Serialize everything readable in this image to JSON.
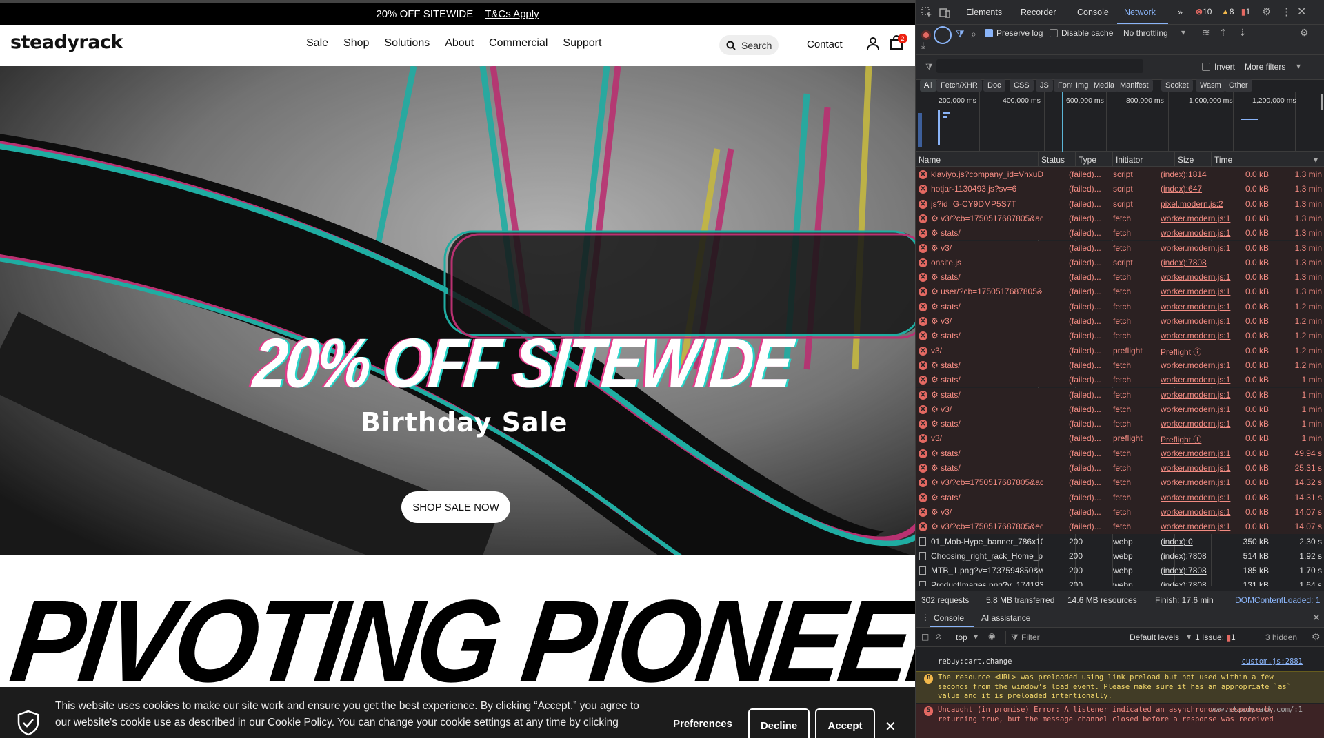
{
  "promo": {
    "text": "20% OFF SITEWIDE",
    "link": "T&Cs Apply"
  },
  "header": {
    "logo": "steadyrack",
    "nav": [
      "Sale",
      "Shop",
      "Solutions",
      "About",
      "Commercial",
      "Support"
    ],
    "search_label": "Search",
    "contact": "Contact",
    "cart_count": "2"
  },
  "hero": {
    "title": "20% OFF SITEWIDE",
    "subtitle": "Birthday Sale",
    "button": "SHOP SALE NOW"
  },
  "headline": "PIVOTING PIONEERS",
  "cookie": {
    "text": "This website uses cookies to make our site work and ensure you get the best experience. By clicking “Accept,” you agree to our website's cookie use as described in our Cookie Policy. You can change your cookie settings at any time by clicking",
    "preferences": "Preferences",
    "decline": "Decline",
    "accept": "Accept"
  },
  "devtools": {
    "tabs": [
      "Elements",
      "Recorder",
      "Console",
      "Network"
    ],
    "active_tab": "Network",
    "errors": "10",
    "warnings": "8",
    "issues": "1",
    "preserve_log": "Preserve log",
    "disable_cache": "Disable cache",
    "throttling": "No throttling",
    "invert": "Invert",
    "more_filters": "More filters",
    "type_filters": [
      "All",
      "Fetch/XHR",
      "Doc",
      "CSS",
      "JS",
      "Font",
      "Img",
      "Media",
      "Manifest",
      "Socket",
      "Wasm",
      "Other"
    ],
    "timeline_labels": [
      "200,000 ms",
      "400,000 ms",
      "600,000 ms",
      "800,000 ms",
      "1,000,000 ms",
      "1,200,000 ms"
    ],
    "columns": [
      "Name",
      "Status",
      "Type",
      "Initiator",
      "Size",
      "Time"
    ],
    "requests": [
      {
        "name": "klaviyo.js?company_id=VhxuDk",
        "status": "(failed)...",
        "type": "script",
        "initiator": "(index):1814",
        "size": "0.0 kB",
        "time": "1.3 min",
        "failed": true
      },
      {
        "name": "hotjar-1130493.js?sv=6",
        "status": "(failed)...",
        "type": "script",
        "initiator": "(index):647",
        "size": "0.0 kB",
        "time": "1.3 min",
        "failed": true
      },
      {
        "name": "js?id=G-CY9DMP5S7T",
        "status": "(failed)...",
        "type": "script",
        "initiator": "pixel.modern.js:2",
        "size": "0.0 kB",
        "time": "1.3 min",
        "failed": true
      },
      {
        "name": "⚙ v3/?cb=1750517687805&ad=...",
        "status": "(failed)...",
        "type": "fetch",
        "initiator": "worker.modern.js:1",
        "size": "0.0 kB",
        "time": "1.3 min",
        "failed": true
      },
      {
        "name": "⚙ stats/",
        "status": "(failed)...",
        "type": "fetch",
        "initiator": "worker.modern.js:1",
        "size": "0.0 kB",
        "time": "1.3 min",
        "failed": true
      },
      {
        "name": "⚙ v3/",
        "status": "(failed)...",
        "type": "fetch",
        "initiator": "worker.modern.js:1",
        "size": "0.0 kB",
        "time": "1.3 min",
        "failed": true
      },
      {
        "name": "onsite.js",
        "status": "(failed)...",
        "type": "script",
        "initiator": "(index):7808",
        "size": "0.0 kB",
        "time": "1.3 min",
        "failed": true
      },
      {
        "name": "⚙ stats/",
        "status": "(failed)...",
        "type": "fetch",
        "initiator": "worker.modern.js:1",
        "size": "0.0 kB",
        "time": "1.3 min",
        "failed": true
      },
      {
        "name": "⚙ user/?cb=1750517687805&e...",
        "status": "(failed)...",
        "type": "fetch",
        "initiator": "worker.modern.js:1",
        "size": "0.0 kB",
        "time": "1.3 min",
        "failed": true
      },
      {
        "name": "⚙ stats/",
        "status": "(failed)...",
        "type": "fetch",
        "initiator": "worker.modern.js:1",
        "size": "0.0 kB",
        "time": "1.2 min",
        "failed": true
      },
      {
        "name": "⚙ v3/",
        "status": "(failed)...",
        "type": "fetch",
        "initiator": "worker.modern.js:1",
        "size": "0.0 kB",
        "time": "1.2 min",
        "failed": true
      },
      {
        "name": "⚙ stats/",
        "status": "(failed)...",
        "type": "fetch",
        "initiator": "worker.modern.js:1",
        "size": "0.0 kB",
        "time": "1.2 min",
        "failed": true
      },
      {
        "name": "v3/",
        "status": "(failed)...",
        "type": "preflight",
        "initiator": "Preflight ⓘ",
        "size": "0.0 kB",
        "time": "1.2 min",
        "failed": true
      },
      {
        "name": "⚙ stats/",
        "status": "(failed)...",
        "type": "fetch",
        "initiator": "worker.modern.js:1",
        "size": "0.0 kB",
        "time": "1.2 min",
        "failed": true
      },
      {
        "name": "⚙ stats/",
        "status": "(failed)...",
        "type": "fetch",
        "initiator": "worker.modern.js:1",
        "size": "0.0 kB",
        "time": "1 min",
        "failed": true
      },
      {
        "name": "⚙ stats/",
        "status": "(failed)...",
        "type": "fetch",
        "initiator": "worker.modern.js:1",
        "size": "0.0 kB",
        "time": "1 min",
        "failed": true
      },
      {
        "name": "⚙ v3/",
        "status": "(failed)...",
        "type": "fetch",
        "initiator": "worker.modern.js:1",
        "size": "0.0 kB",
        "time": "1 min",
        "failed": true
      },
      {
        "name": "⚙ stats/",
        "status": "(failed)...",
        "type": "fetch",
        "initiator": "worker.modern.js:1",
        "size": "0.0 kB",
        "time": "1 min",
        "failed": true
      },
      {
        "name": "v3/",
        "status": "(failed)...",
        "type": "preflight",
        "initiator": "Preflight ⓘ",
        "size": "0.0 kB",
        "time": "1 min",
        "failed": true
      },
      {
        "name": "⚙ stats/",
        "status": "(failed)...",
        "type": "fetch",
        "initiator": "worker.modern.js:1",
        "size": "0.0 kB",
        "time": "49.94 s",
        "failed": true
      },
      {
        "name": "⚙ stats/",
        "status": "(failed)...",
        "type": "fetch",
        "initiator": "worker.modern.js:1",
        "size": "0.0 kB",
        "time": "25.31 s",
        "failed": true
      },
      {
        "name": "⚙ v3/?cb=1750517687805&ad=...",
        "status": "(failed)...",
        "type": "fetch",
        "initiator": "worker.modern.js:1",
        "size": "0.0 kB",
        "time": "14.32 s",
        "failed": true
      },
      {
        "name": "⚙ stats/",
        "status": "(failed)...",
        "type": "fetch",
        "initiator": "worker.modern.js:1",
        "size": "0.0 kB",
        "time": "14.31 s",
        "failed": true
      },
      {
        "name": "⚙ v3/",
        "status": "(failed)...",
        "type": "fetch",
        "initiator": "worker.modern.js:1",
        "size": "0.0 kB",
        "time": "14.07 s",
        "failed": true
      },
      {
        "name": "⚙ v3/?cb=1750517687805&ed=...",
        "status": "(failed)...",
        "type": "fetch",
        "initiator": "worker.modern.js:1",
        "size": "0.0 kB",
        "time": "14.07 s",
        "failed": true
      },
      {
        "name": "01_Mob-Hype_banner_786x10...",
        "status": "200",
        "type": "webp",
        "initiator": "(index):0",
        "size": "350 kB",
        "time": "2.30 s",
        "failed": false
      },
      {
        "name": "Choosing_right_rack_Home_pa...",
        "status": "200",
        "type": "webp",
        "initiator": "(index):7808",
        "size": "514 kB",
        "time": "1.92 s",
        "failed": false
      },
      {
        "name": "MTB_1.png?v=1737594850&wi...",
        "status": "200",
        "type": "webp",
        "initiator": "(index):7808",
        "size": "185 kB",
        "time": "1.70 s",
        "failed": false
      },
      {
        "name": "ProductImages.png?v=1741939...",
        "status": "200",
        "type": "webp",
        "initiator": "(index):7808",
        "size": "131 kB",
        "time": "1.64 s",
        "failed": false
      }
    ],
    "summary": {
      "requests": "302 requests",
      "transferred": "5.8 MB transferred",
      "resources": "14.6 MB resources",
      "finish": "Finish: 17.6 min",
      "dcl": "DOMContentLoaded: 1"
    },
    "console": {
      "tabs": [
        "Console",
        "AI assistance"
      ],
      "context": "top",
      "filter": "Filter",
      "levels": "Default levels",
      "issues": "1 Issue:",
      "issues_count": "1",
      "hidden": "3 hidden",
      "messages": [
        {
          "text": "rebuy:cart.change",
          "source": "custom.js:2881",
          "level": "info"
        },
        {
          "badge": "8",
          "text": "The resource <URL> was preloaded using link preload but not used within a few seconds from the window's load event. Please make sure it has an appropriate `as` value and it is preloaded intentionally.",
          "level": "warning"
        },
        {
          "badge": "5",
          "text": "Uncaught (in promise) Error: A listener indicated an asynchronous response by returning true, but the message channel closed before a response was received",
          "source": "www.steadyrack.com/:1",
          "level": "error"
        }
      ]
    }
  }
}
